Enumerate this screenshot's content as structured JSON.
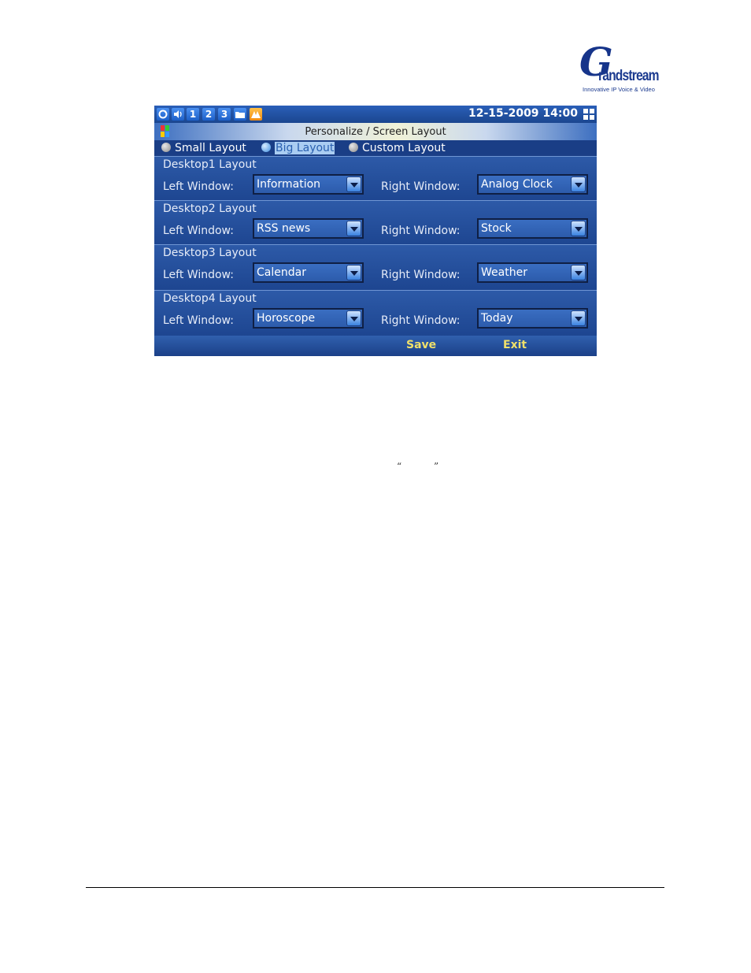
{
  "logo": {
    "letter": "G",
    "word": "randstream",
    "tagline": "Innovative IP Voice & Video"
  },
  "statusbar": {
    "icons": [
      "sync-icon",
      "volume-icon",
      "line-1",
      "line-2",
      "line-3",
      "folder-icon",
      "alert-icon"
    ],
    "line1": "1",
    "line2": "2",
    "line3": "3",
    "datetime": "12-15-2009 14:00"
  },
  "titlebar": {
    "title": "Personalize / Screen Layout"
  },
  "layout_options": {
    "small": "Small Layout",
    "big": "Big Layout",
    "custom": "Custom Layout",
    "selected": "Big Layout"
  },
  "desktops": [
    {
      "title": "Desktop1 Layout",
      "left_label": "Left Window:",
      "left_value": "Information",
      "right_label": "Right Window:",
      "right_value": "Analog Clock"
    },
    {
      "title": "Desktop2 Layout",
      "left_label": "Left Window:",
      "left_value": "RSS news",
      "right_label": "Right Window:",
      "right_value": "Stock"
    },
    {
      "title": "Desktop3 Layout",
      "left_label": "Left Window:",
      "left_value": "Calendar",
      "right_label": "Right Window:",
      "right_value": "Weather"
    },
    {
      "title": "Desktop4 Layout",
      "left_label": "Left Window:",
      "left_value": "Horoscope",
      "right_label": "Right Window:",
      "right_value": "Today"
    }
  ],
  "softkeys": {
    "save": "Save",
    "exit": "Exit"
  },
  "colors": {
    "screen_bg": "#1e4a96",
    "softkey_text": "#f0e06a",
    "logo_blue": "#16348a"
  },
  "document": {
    "open_quote": "“",
    "close_quote": "”"
  }
}
